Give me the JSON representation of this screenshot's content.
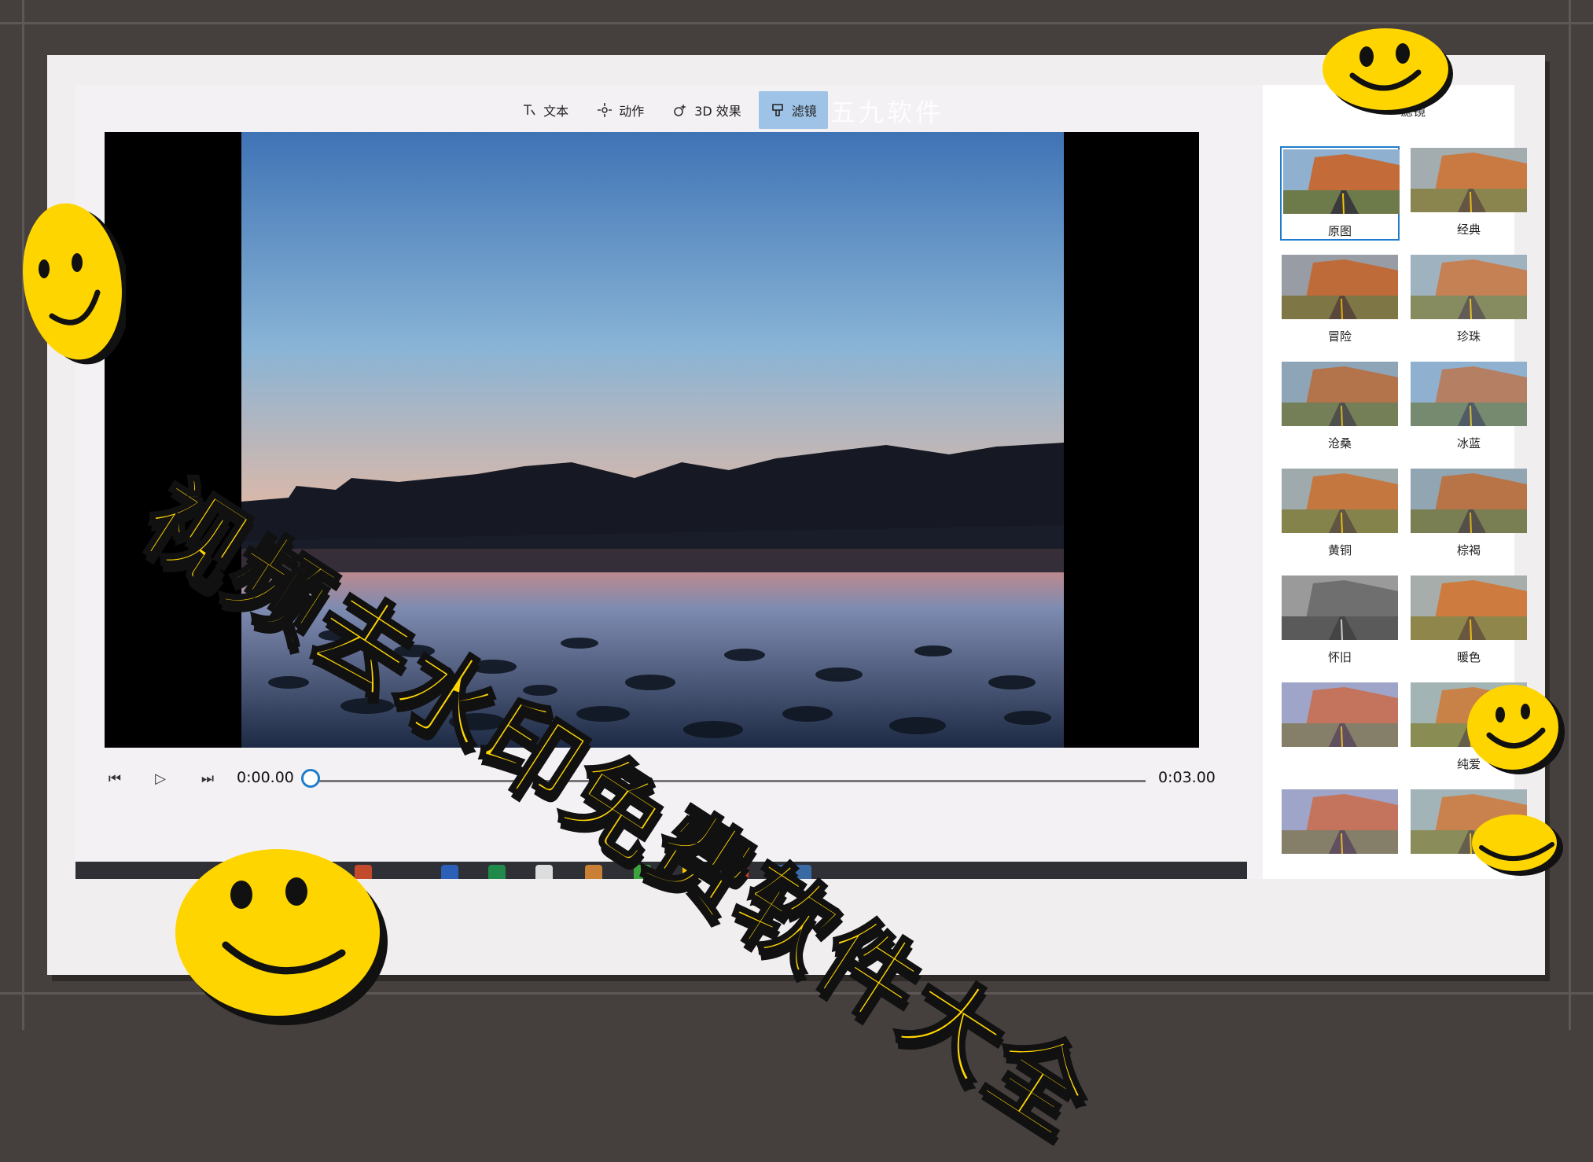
{
  "toolbar": {
    "buttons": [
      {
        "label": "文本",
        "icon": "text-icon",
        "active": false
      },
      {
        "label": "动作",
        "icon": "motion-icon",
        "active": false
      },
      {
        "label": "3D 效果",
        "icon": "3d-effects-icon",
        "active": false
      },
      {
        "label": "滤镜",
        "icon": "filter-icon",
        "active": true
      }
    ],
    "watermark": "五九软件"
  },
  "playback": {
    "current_time": "0:00.00",
    "total_time": "0:03.00",
    "progress": 0.0
  },
  "filters_panel": {
    "title": "滤镜",
    "items": [
      "原图",
      "经典",
      "冒险",
      "珍珠",
      "沧桑",
      "冰蓝",
      "黄铜",
      "棕褐",
      "怀旧",
      "暖色",
      "",
      "纯爱",
      "",
      ""
    ],
    "selected": "原图"
  },
  "overlay": {
    "headline": "视频去水印免费软件大全"
  },
  "colors": {
    "accent": "#1f7ccb",
    "active_tab": "#9ec3e6",
    "headline": "#ffd500",
    "smiley": "#ffd500"
  }
}
